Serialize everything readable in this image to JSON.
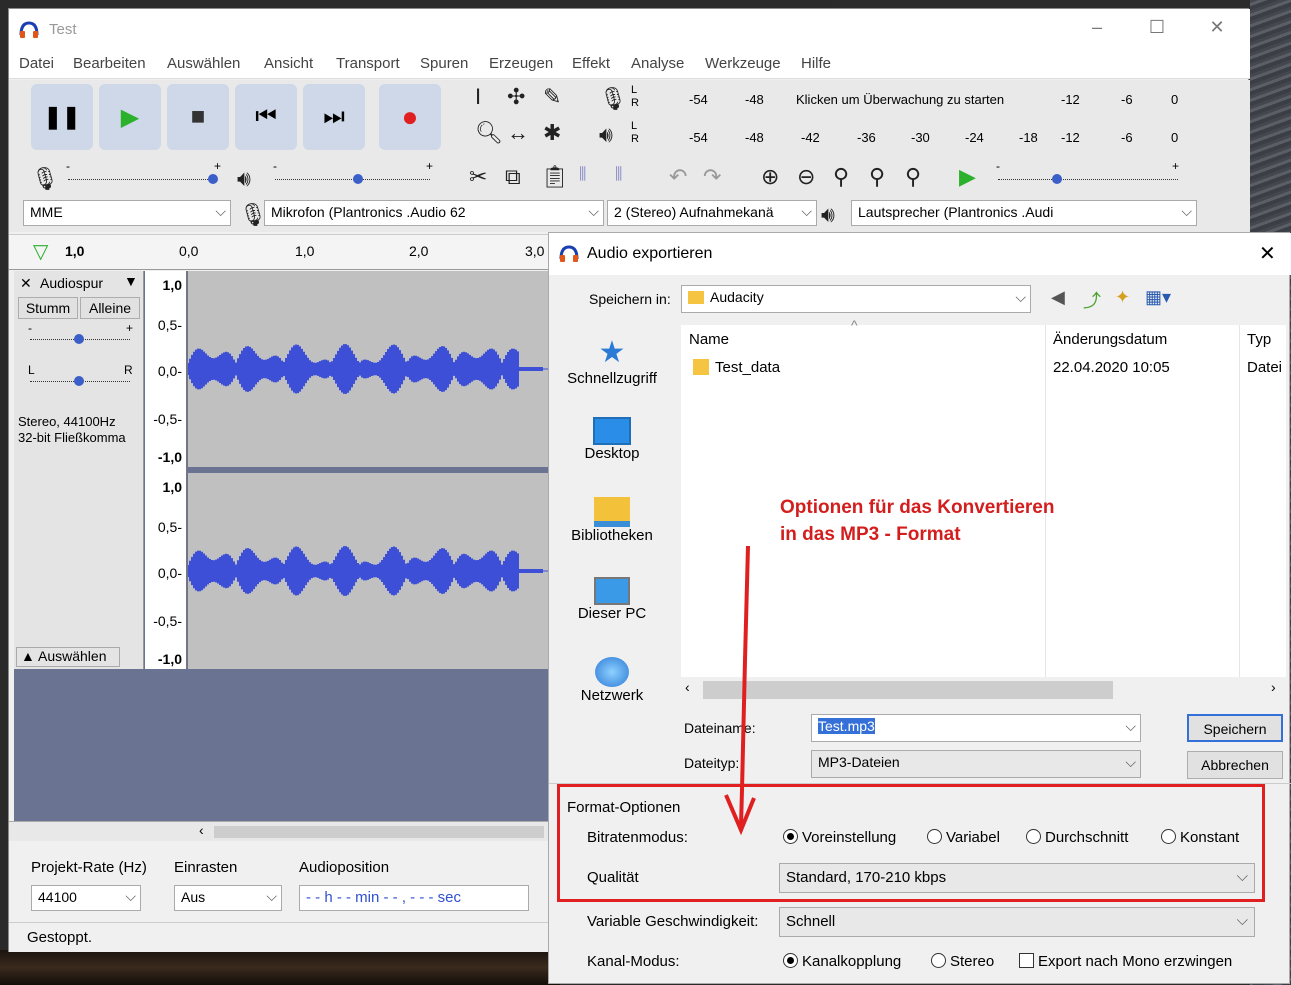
{
  "app": {
    "title": "Test"
  },
  "menu": [
    "Datei",
    "Bearbeiten",
    "Auswählen",
    "Ansicht",
    "Transport",
    "Spuren",
    "Erzeugen",
    "Effekt",
    "Analyse",
    "Werkzeuge",
    "Hilfe"
  ],
  "meters": {
    "rec_ticks": [
      "-54",
      "-48",
      "-12",
      "-6",
      "0"
    ],
    "rec_hint": "Klicken um Überwachung zu starten",
    "play_ticks": [
      "-54",
      "-48",
      "-42",
      "-36",
      "-30",
      "-24",
      "-18",
      "-12",
      "-6",
      "0"
    ],
    "lr": {
      "l": "L",
      "r": "R"
    }
  },
  "slider_marks": {
    "minus": "-",
    "plus": "+",
    "l": "L",
    "r": "R"
  },
  "devices": {
    "host": "MME",
    "input": "Mikrofon (Plantronics .Audio 62",
    "channels": "2 (Stereo) Aufnahmekanä",
    "output": "Lautsprecher (Plantronics .Audi"
  },
  "timeline": [
    "1,0",
    "0,0",
    "1,0",
    "2,0",
    "3,0"
  ],
  "track": {
    "name": "Audiospur",
    "mute": "Stumm",
    "solo": "Alleine",
    "info1": "Stereo, 44100Hz",
    "info2": "32-bit Fließkomma",
    "select": "Auswählen",
    "scale_top": [
      "1,0",
      "0,5-",
      "0,0-",
      "-0,5-",
      "-1,0"
    ],
    "scale_bottom": [
      "1,0",
      "0,5-",
      "0,0-",
      "-0,5-",
      "-1,0"
    ]
  },
  "bottom": {
    "rate_label": "Projekt-Rate (Hz)",
    "rate_value": "44100",
    "snap_label": "Einrasten",
    "snap_value": "Aus",
    "pos_label": "Audioposition",
    "pos_value": "- - h - - min - - , - - - sec",
    "status": "Gestoppt."
  },
  "dialog": {
    "title": "Audio exportieren",
    "save_in_label": "Speichern in:",
    "save_in_value": "Audacity",
    "sidebar": [
      "Schnellzugriff",
      "Desktop",
      "Bibliotheken",
      "Dieser PC",
      "Netzwerk"
    ],
    "columns": {
      "name": "Name",
      "date": "Änderungsdatum",
      "type": "Typ"
    },
    "files": [
      {
        "name": "Test_data",
        "date": "22.04.2020 10:05",
        "type": "Datei"
      }
    ],
    "filename_label": "Dateiname:",
    "filename_value": "Test.mp3",
    "filetype_label": "Dateityp:",
    "filetype_value": "MP3-Dateien",
    "save_button": "Speichern",
    "cancel_button": "Abbrechen",
    "format_title": "Format-Optionen",
    "bitrate_label": "Bitratenmodus:",
    "bitrate_options": [
      "Voreinstellung",
      "Variabel",
      "Durchschnitt",
      "Konstant"
    ],
    "quality_label": "Qualität",
    "quality_value": "Standard, 170-210 kbps",
    "speed_label": "Variable Geschwindigkeit:",
    "speed_value": "Schnell",
    "channel_label": "Kanal-Modus:",
    "channel_options": [
      "Kanalkopplung",
      "Stereo"
    ],
    "mono_label": "Export nach Mono erzwingen"
  },
  "annotation": {
    "line1": "Optionen für das Konvertieren",
    "line2": "in das MP3 - Format"
  },
  "colors": {
    "accent_red": "#e02020",
    "waveform": "#3c4fd6",
    "track_bg": "#6b7392"
  }
}
